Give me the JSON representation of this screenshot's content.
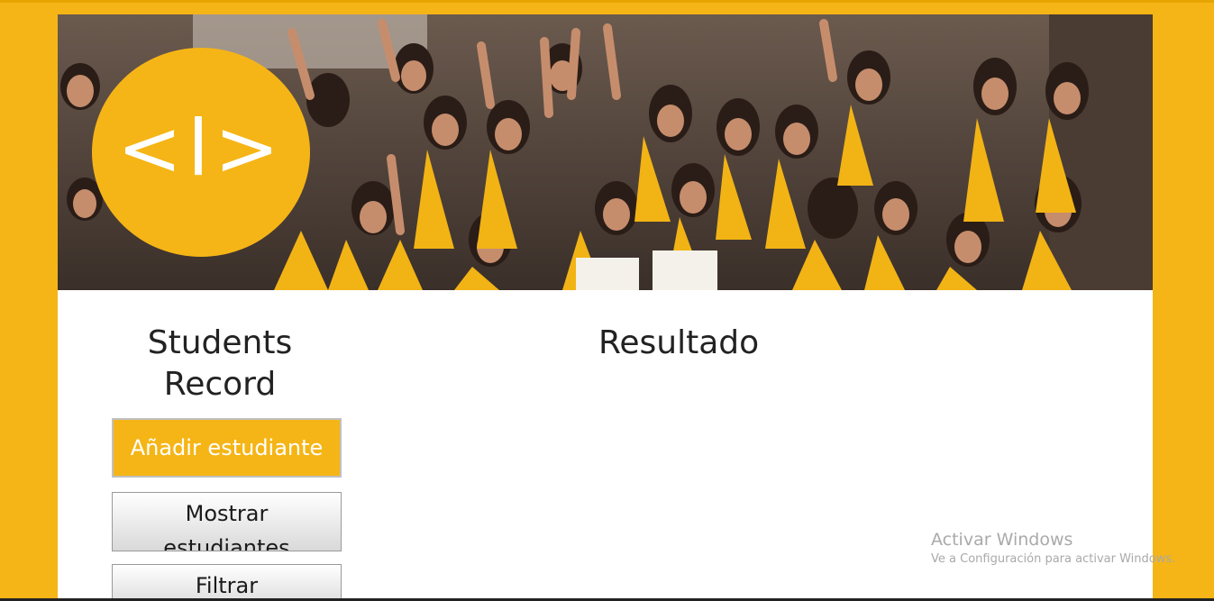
{
  "header": {
    "banner_photo": "graduates-group-photo",
    "logo_text": "<l>"
  },
  "sidebar": {
    "title_line1": "Students",
    "title_line2": "Record",
    "add_button": "Añadir estudiante",
    "show_button_line1": "Mostrar",
    "show_button_line2": "estudiantes",
    "filter_button": "Filtrar"
  },
  "main": {
    "result_title": "Resultado"
  },
  "watermark": {
    "title": "Activar Windows",
    "subtitle": "Ve a Configuración para activar Windows."
  },
  "colors": {
    "accent": "#f5b516",
    "background": "#ffffff",
    "text": "#222222"
  }
}
